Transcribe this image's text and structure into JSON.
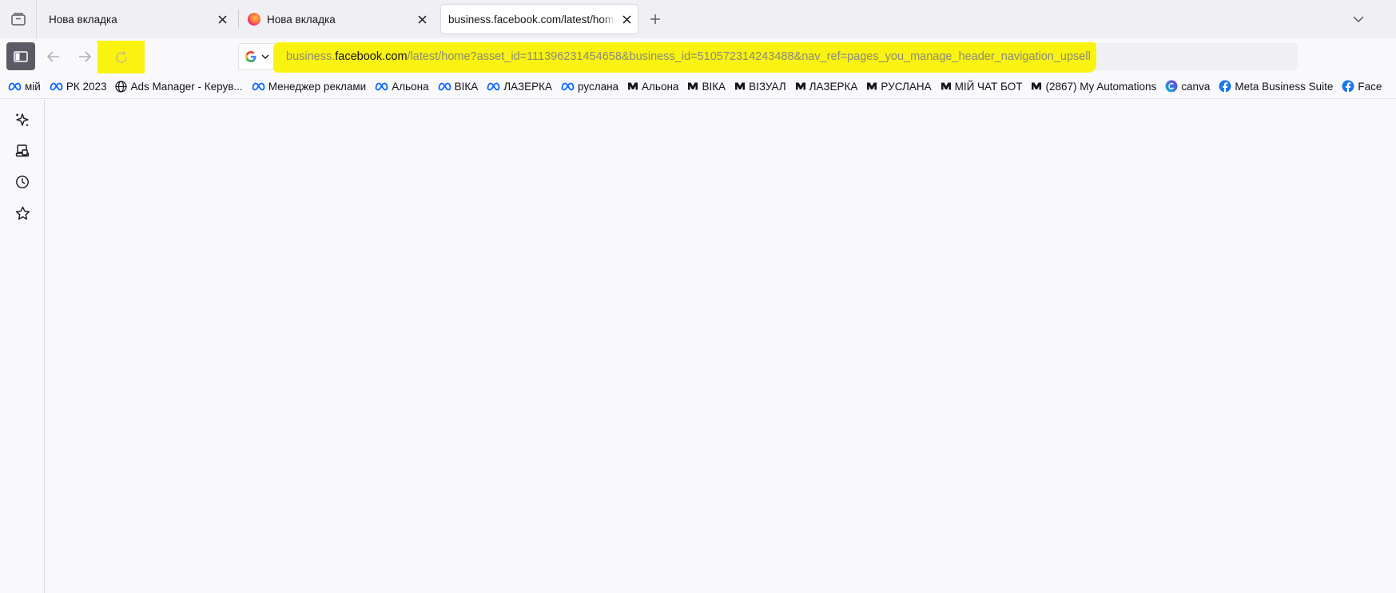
{
  "tabs": [
    {
      "title": "Нова вкладка",
      "active": false,
      "favicon": "none"
    },
    {
      "title": "Нова вкладка",
      "active": false,
      "favicon": "firefox-icon"
    },
    {
      "title": "business.facebook.com/latest/home?",
      "active": true,
      "favicon": "none"
    }
  ],
  "urlbar": {
    "url_prefix": "business.",
    "url_domain": "facebook.com",
    "url_path": "/latest/home?asset_id=111396231454658&business_id=510572314243488&nav_ref=pages_you_manage_header_navigation_upsell",
    "search_engine": "Google"
  },
  "bookmarks": [
    {
      "label": "мій",
      "icon": "meta-icon"
    },
    {
      "label": "РК 2023",
      "icon": "meta-icon"
    },
    {
      "label": "Ads Manager - Керув...",
      "icon": "globe-icon"
    },
    {
      "label": "Менеджер реклами",
      "icon": "meta-icon"
    },
    {
      "label": "Альона",
      "icon": "meta-icon"
    },
    {
      "label": "ВІКА",
      "icon": "meta-icon"
    },
    {
      "label": "ЛАЗЕРКА",
      "icon": "meta-icon"
    },
    {
      "label": "руслана",
      "icon": "meta-icon"
    },
    {
      "label": "Альона",
      "icon": "manychat-icon"
    },
    {
      "label": "ВІКА",
      "icon": "manychat-icon"
    },
    {
      "label": "ВІЗУАЛ",
      "icon": "manychat-icon"
    },
    {
      "label": "ЛАЗЕРКА",
      "icon": "manychat-icon"
    },
    {
      "label": "РУСЛАНА",
      "icon": "manychat-icon"
    },
    {
      "label": "МІЙ ЧАТ БОТ",
      "icon": "manychat-icon"
    },
    {
      "label": "(2867) My Automations",
      "icon": "manychat-icon"
    },
    {
      "label": "canva",
      "icon": "canva-icon"
    },
    {
      "label": "Meta Business Suite",
      "icon": "facebook-icon"
    },
    {
      "label": "Face",
      "icon": "facebook-icon"
    }
  ],
  "sidebar": [
    {
      "icon": "ai-sparkle-icon"
    },
    {
      "icon": "synced-tabs-icon"
    },
    {
      "icon": "history-icon"
    },
    {
      "icon": "bookmarks-star-icon"
    }
  ],
  "colors": {
    "highlight": "#f9f30f",
    "meta_blue": "#0866ff",
    "facebook_blue": "#1877f2",
    "canva": "#7d2ae8"
  }
}
